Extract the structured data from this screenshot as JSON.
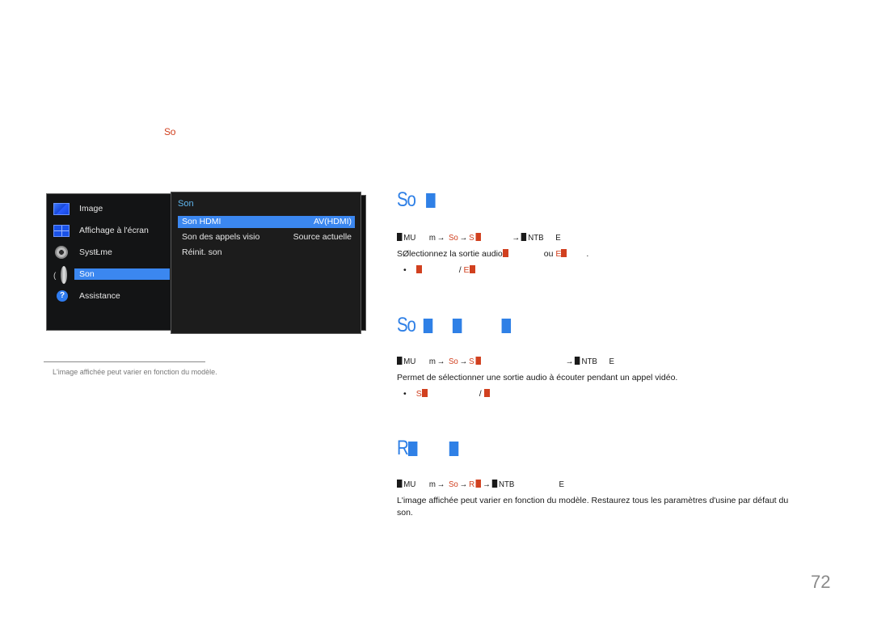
{
  "top_label": "So",
  "osd": {
    "left_menu": [
      {
        "icon": "picture-icon",
        "label": "Image",
        "selected": false
      },
      {
        "icon": "onscreen-display-icon",
        "label": "Affichage à l'écran",
        "selected": false
      },
      {
        "icon": "gear-icon",
        "label": "SystŁme",
        "selected": false
      },
      {
        "icon": "speaker-icon",
        "label": "Son",
        "selected": true
      },
      {
        "icon": "help-icon",
        "label": "Assistance",
        "selected": false
      }
    ],
    "submenu_title": "Son",
    "submenu": [
      {
        "label": "Son HDMI",
        "value": "AV(HDMI)",
        "selected": true
      },
      {
        "label": "Son des appels visio",
        "value": "Source actuelle",
        "selected": false
      },
      {
        "label": "Réinit. son",
        "value": "",
        "selected": false
      }
    ]
  },
  "caption": "L'image affichée peut varier en fonction du modèle.",
  "sections": [
    {
      "heading": "So",
      "path": {
        "menu": "MU",
        "m": "m",
        "arrow": "→",
        "son": "So",
        "item": "S",
        "enter": "NTB",
        "e": "E"
      },
      "description": "SØlectionnez la sortie audio",
      "description_ou": "ou",
      "description_end": ".",
      "bullet_sep": "/"
    },
    {
      "heading": "So",
      "path": {
        "menu": "MU",
        "m": "m",
        "arrow": "→",
        "son": "So",
        "item": "S",
        "enter": "NTB",
        "e": "E"
      },
      "description": "Permet de sélectionner une sortie audio à écouter pendant un appel vidéo.",
      "bullet_text": "S",
      "bullet_sep": "/"
    },
    {
      "heading": "R",
      "path": {
        "menu": "MU",
        "m": "m",
        "arrow": "→",
        "son": "So",
        "item": "R",
        "enter": "NTB",
        "e": "E"
      },
      "description_line1": "L'image affichée peut varier en fonction du modèle. Restaurez tous les paramètres d'usine par défaut du",
      "description_line2": "son."
    }
  ],
  "page_number": "72",
  "colors": {
    "accent_red": "#d1401f",
    "heading_blue": "#2f80e6",
    "osd_highlight": "#3b87f0",
    "osd_title": "#5fb6ee"
  }
}
